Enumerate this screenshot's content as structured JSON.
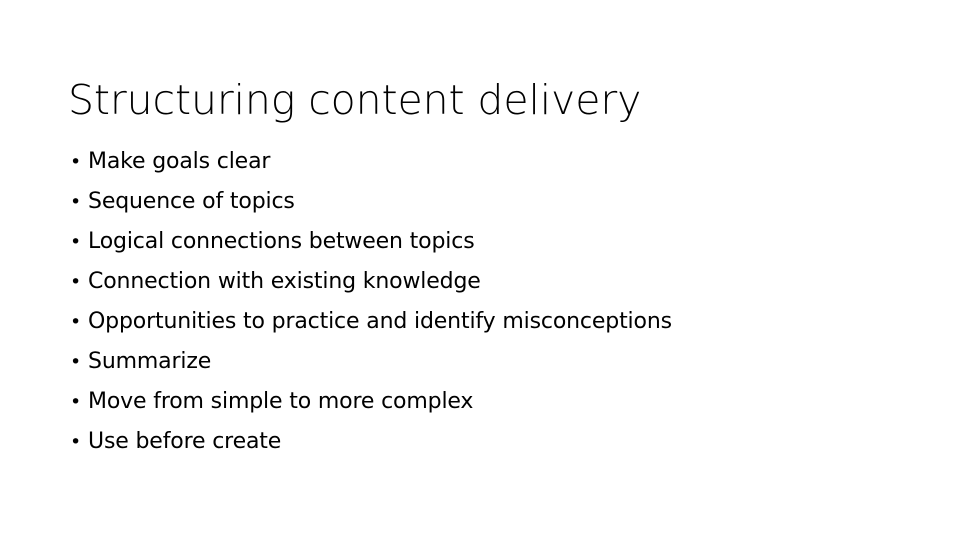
{
  "slide": {
    "background_color": "#FFFFFF",
    "text_color": "#000000",
    "title": "Structuring content delivery",
    "bullet_marker": "•",
    "bullets": [
      {
        "text": "Make goals clear"
      },
      {
        "text": "Sequence of topics"
      },
      {
        "text": "Logical connections between topics"
      },
      {
        "text": "Connection with existing knowledge"
      },
      {
        "text": "Opportunities to practice and identify misconceptions"
      },
      {
        "text": "Summarize"
      },
      {
        "text": "Move from simple to more complex"
      },
      {
        "text": "Use before create"
      }
    ]
  }
}
